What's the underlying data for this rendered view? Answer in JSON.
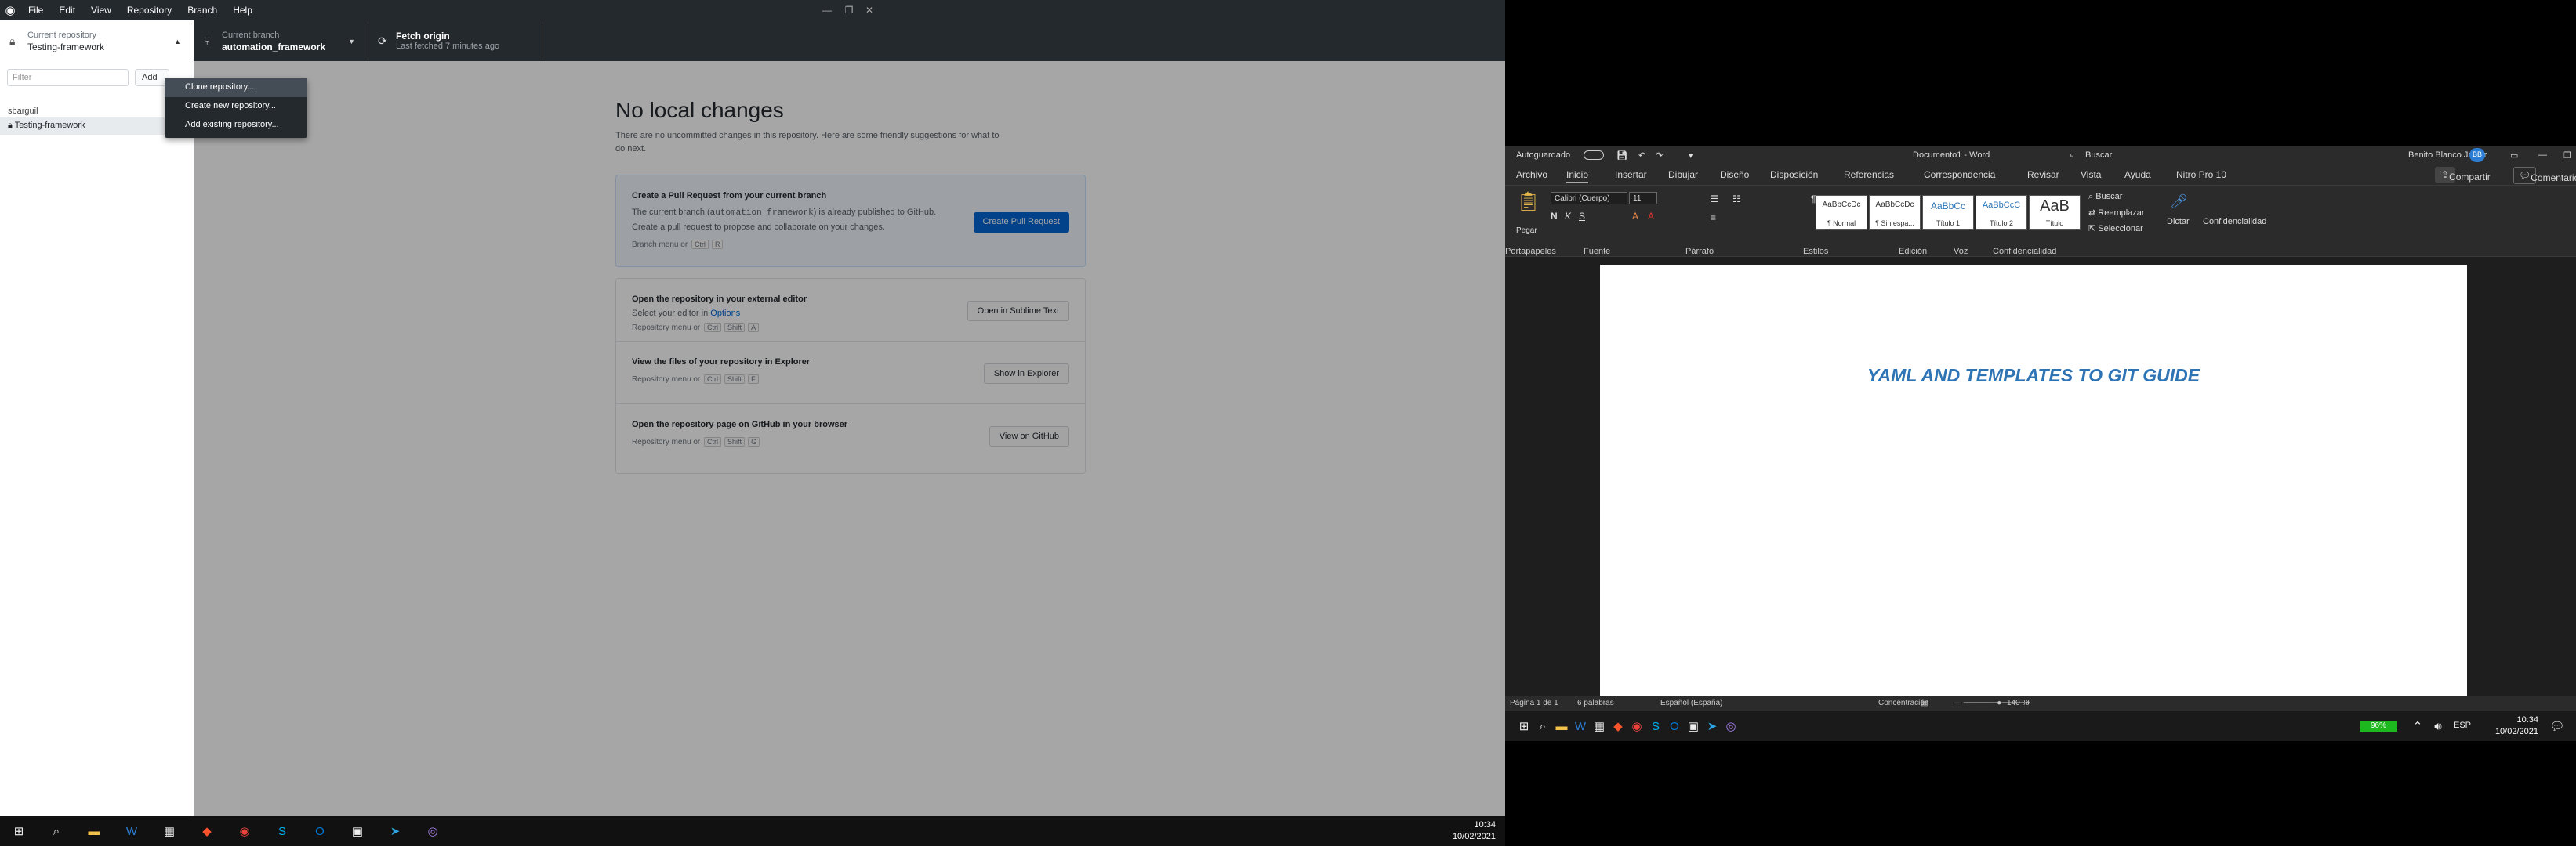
{
  "gh": {
    "menu": [
      "File",
      "Edit",
      "View",
      "Repository",
      "Branch",
      "Help"
    ],
    "repo": {
      "label": "Current repository",
      "value": "Testing-framework"
    },
    "branch": {
      "label": "Current branch",
      "value": "automation_framework"
    },
    "fetch": {
      "label": "Fetch origin",
      "sub": "Last fetched 7 minutes ago"
    },
    "filter_placeholder": "Filter",
    "add_label": "Add",
    "group": "sbarguil",
    "repo_item": "Testing-framework",
    "dropdown": [
      "Clone repository...",
      "Create new repository...",
      "Add existing repository..."
    ],
    "nolocal": {
      "title": "No local changes",
      "desc": "There are no uncommitted changes in this repository. Here are some friendly suggestions for what to do next."
    },
    "pr": {
      "title": "Create a Pull Request from your current branch",
      "d1": "The current branch (",
      "branch_code": "automation_framework",
      "d2": ") is already published to GitHub. Create a pull request to propose and collaborate on your changes.",
      "shortcut_text": "Branch menu or",
      "k1": "Ctrl",
      "k2": "R",
      "button": "Create Pull Request"
    },
    "rows": [
      {
        "title": "Open the repository in your external editor",
        "desc_pre": "Select your editor in ",
        "desc_link": "Options",
        "shortcut_text": "Repository menu or",
        "keys": [
          "Ctrl",
          "Shift",
          "A"
        ],
        "button": "Open in Sublime Text"
      },
      {
        "title": "View the files of your repository in Explorer",
        "desc_pre": "",
        "desc_link": "",
        "shortcut_text": "Repository menu or",
        "keys": [
          "Ctrl",
          "Shift",
          "F"
        ],
        "button": "Show in Explorer"
      },
      {
        "title": "Open the repository page on GitHub in your browser",
        "desc_pre": "",
        "desc_link": "",
        "shortcut_text": "Repository menu or",
        "keys": [
          "Ctrl",
          "Shift",
          "G"
        ],
        "button": "View on GitHub"
      }
    ],
    "clock": {
      "time": "10:34",
      "date": "10/02/2021"
    }
  },
  "word": {
    "autosave": "Autoguardado",
    "doc": "Documento1  -  Word",
    "search": "Buscar",
    "user": "Benito Blanco Javier",
    "avatar": "BB",
    "tabs": [
      "Archivo",
      "Inicio",
      "Insertar",
      "Dibujar",
      "Diseño",
      "Disposición",
      "Referencias",
      "Correspondencia",
      "Revisar",
      "Vista",
      "Ayuda",
      "Nitro Pro 10"
    ],
    "share": "Compartir",
    "comments": "Comentarios",
    "font": "Calibri (Cuerpo)",
    "size": "11",
    "paste": "Pegar",
    "styles": [
      {
        "sample": "AaBbCcDc",
        "name": "¶ Normal"
      },
      {
        "sample": "AaBbCcDc",
        "name": "¶ Sin espa..."
      },
      {
        "sample": "AaBbCc",
        "name": "Título 1"
      },
      {
        "sample": "AaBbCcC",
        "name": "Título 2"
      },
      {
        "sample": "AaB",
        "name": "Título"
      }
    ],
    "edit": [
      "Buscar",
      "Reemplazar",
      "Seleccionar"
    ],
    "dictate": "Dictar",
    "confidential": "Confidencialidad",
    "groups": [
      "Portapapeles",
      "Fuente",
      "Párrafo",
      "Estilos",
      "Edición",
      "Voz",
      "Confidencialidad"
    ],
    "heading": "YAML AND TEMPLATES TO GIT GUIDE",
    "status": {
      "page": "Página 1 de 1",
      "words": "6 palabras",
      "lang": "Español (España)",
      "focus": "Concentración",
      "zoom": "140 %"
    },
    "battery": "96%",
    "lang": "ESP",
    "clock": {
      "time": "10:34",
      "date": "10/02/2021"
    }
  }
}
